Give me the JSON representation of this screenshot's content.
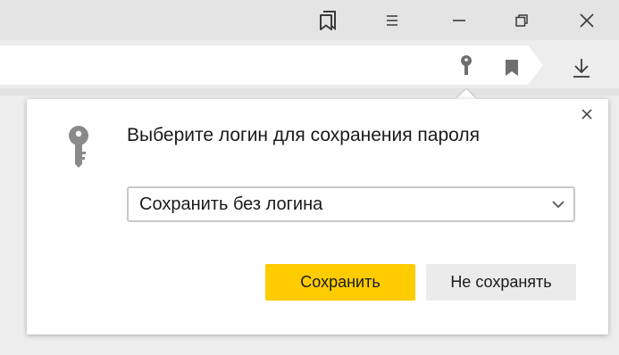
{
  "titlebar": {
    "icons": [
      "bookmarks-panel-icon",
      "menu-icon",
      "minimize-icon",
      "restore-icon",
      "close-icon"
    ]
  },
  "addressbar": {
    "icons": [
      "password-key-icon",
      "bookmark-icon",
      "downloads-icon"
    ]
  },
  "dialog": {
    "title": "Выберите логин для сохранения пароля",
    "login_select": {
      "selected": "Сохранить без логина"
    },
    "save_button": "Сохранить",
    "dont_save_button": "Не сохранять"
  },
  "colors": {
    "save_button_bg": "#ffcc00",
    "dont_save_button_bg": "#ebebeb",
    "icon_gray": "#8a8a8a"
  }
}
